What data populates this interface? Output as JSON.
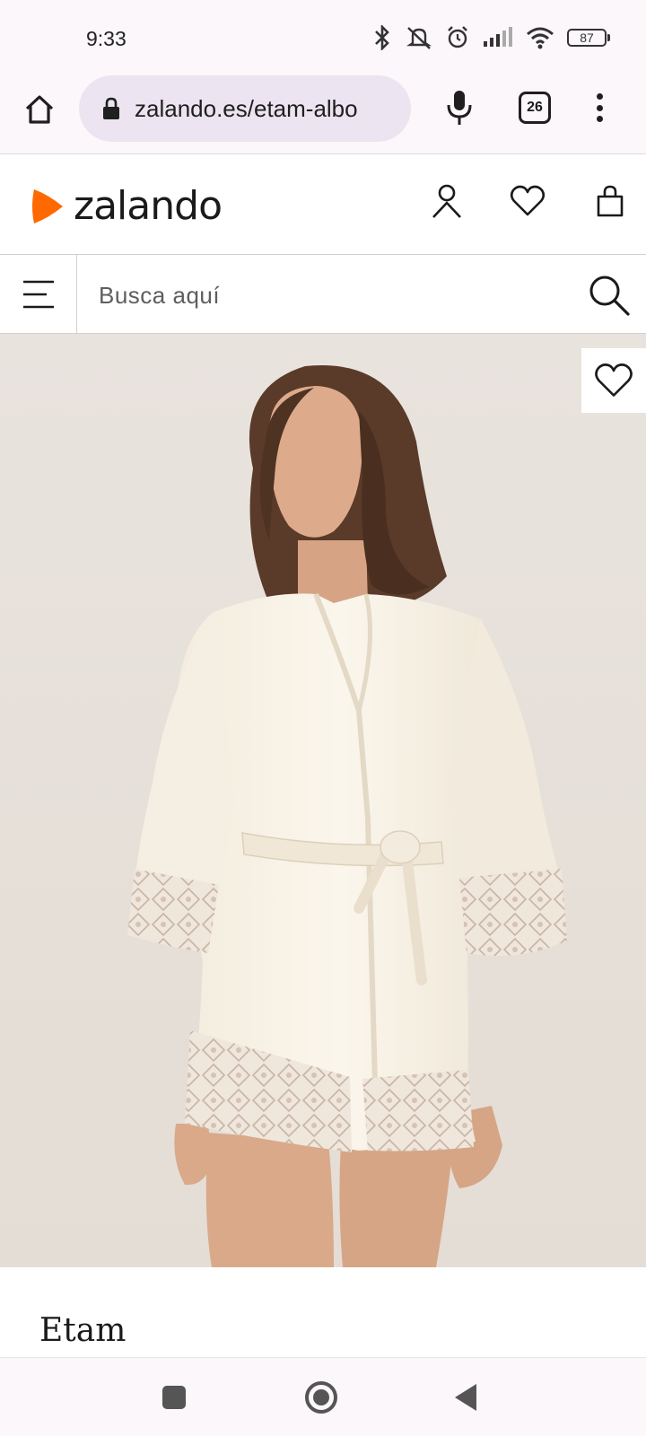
{
  "status_bar": {
    "time": "9:33",
    "battery": "87",
    "icons": [
      "bluetooth-icon",
      "mute-icon",
      "alarm-icon",
      "signal-icon",
      "wifi-icon",
      "battery-icon"
    ]
  },
  "browser": {
    "url": "zalando.es/etam-albo",
    "tab_count": "26",
    "icons": [
      "home-icon",
      "lock-icon",
      "mic-icon",
      "tabs-icon",
      "more-vert-icon"
    ]
  },
  "header": {
    "logo_text": "zalando",
    "brand_color": "#ff6900",
    "icons": [
      "account-icon",
      "wishlist-icon",
      "bag-icon"
    ]
  },
  "search": {
    "placeholder": "Busca aquí"
  },
  "product": {
    "image_alt": "Woman wearing ivory satin kimono robe with lace trim",
    "brand": "Etam"
  },
  "nav": {
    "icons": [
      "recents-icon",
      "home-circle-icon",
      "back-icon"
    ]
  }
}
